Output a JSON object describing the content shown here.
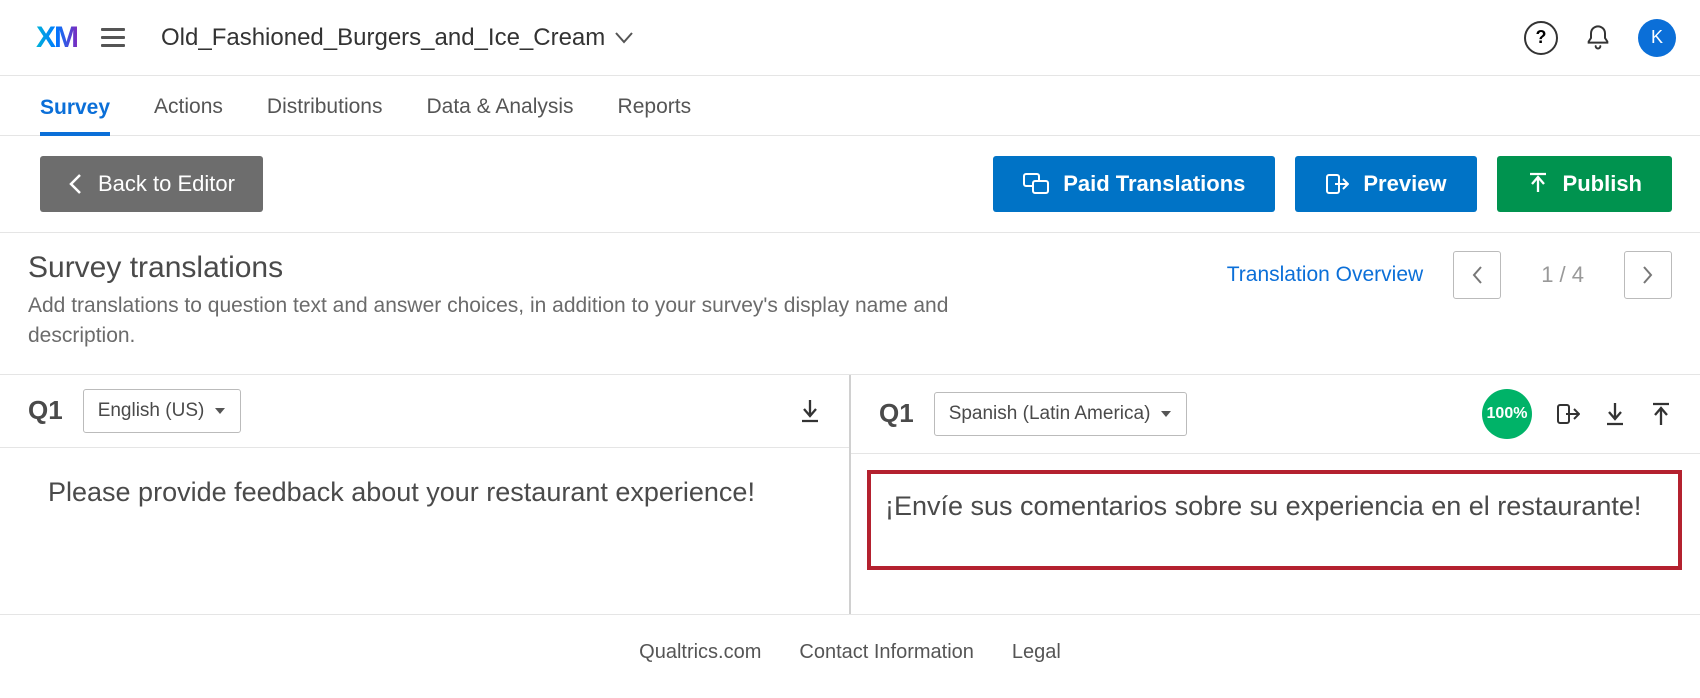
{
  "header": {
    "logo_text": "XM",
    "project_name": "Old_Fashioned_Burgers_and_Ice_Cream",
    "avatar_letter": "K"
  },
  "tabs": [
    {
      "label": "Survey",
      "active": true
    },
    {
      "label": "Actions",
      "active": false
    },
    {
      "label": "Distributions",
      "active": false
    },
    {
      "label": "Data & Analysis",
      "active": false
    },
    {
      "label": "Reports",
      "active": false
    }
  ],
  "actionbar": {
    "back_label": "Back to Editor",
    "paid_label": "Paid Translations",
    "preview_label": "Preview",
    "publish_label": "Publish"
  },
  "title": {
    "heading": "Survey translations",
    "sub": "Add translations to question text and answer choices, in addition to your survey's display name and description.",
    "overview": "Translation Overview",
    "page": "1 / 4"
  },
  "source": {
    "qnum": "Q1",
    "lang": "English (US)",
    "text": "Please provide feedback about your restaurant experience!"
  },
  "target": {
    "qnum": "Q1",
    "lang": "Spanish (Latin America)",
    "pct": "100%",
    "text": "¡Envíe sus comentarios sobre su experiencia en el restaurante!"
  },
  "footer": {
    "l1": "Qualtrics.com",
    "l2": "Contact Information",
    "l3": "Legal"
  }
}
